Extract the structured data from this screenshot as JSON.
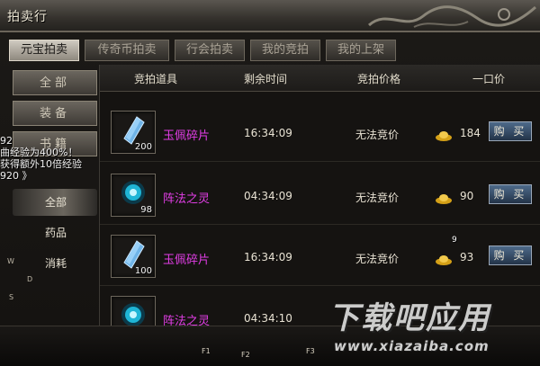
{
  "window": {
    "title": "拍卖行"
  },
  "tabs": [
    {
      "label": "元宝拍卖",
      "active": true
    },
    {
      "label": "传奇币拍卖",
      "active": false
    },
    {
      "label": "行会拍卖",
      "active": false
    },
    {
      "label": "我的竞拍",
      "active": false
    },
    {
      "label": "我的上架",
      "active": false
    }
  ],
  "categories": [
    "全部",
    "装备",
    "书籍"
  ],
  "subtabs": [
    {
      "label": "全部",
      "active": true
    },
    {
      "label": "药品",
      "active": false
    },
    {
      "label": "消耗",
      "active": false
    }
  ],
  "chat": [
    "92",
    "曲经验为400%！",
    "获得额外10倍经验",
    "920 》"
  ],
  "table": {
    "headers": {
      "item": "竞拍道具",
      "time": "剩余时间",
      "price": "竞拍价格",
      "buyout": "一口价"
    },
    "rows": [
      {
        "name": "玉佩碎片",
        "qty": "200",
        "time": "16:34:09",
        "price": "无法竞价",
        "buyout": "184",
        "buy": "购 买",
        "icon": "crystal-shard-icon"
      },
      {
        "name": "阵法之灵",
        "qty": "98",
        "time": "04:34:09",
        "price": "无法竞价",
        "buyout": "90",
        "buy": "购 买",
        "icon": "spirit-orb-icon"
      },
      {
        "name": "玉佩碎片",
        "qty": "100",
        "time": "16:34:09",
        "price": "无法竞价",
        "buyout": "93",
        "buy": "购 买",
        "icon": "crystal-shard-icon"
      },
      {
        "name": "阵法之灵",
        "qty": "",
        "time": "04:34:10",
        "price": "",
        "buyout": "",
        "buy": "",
        "icon": "spirit-orb-icon"
      }
    ],
    "overlay_num": "9"
  },
  "fkeys": [
    "F1",
    "F2",
    "F3"
  ],
  "compass": [
    "W",
    "D",
    "S"
  ],
  "watermark": {
    "cn": "下载吧应用",
    "en": "www.xiazaiba.com"
  },
  "colors": {
    "item_name": "#e23ee6",
    "buy_button": "#2f4560",
    "gold": "#e6b422"
  }
}
